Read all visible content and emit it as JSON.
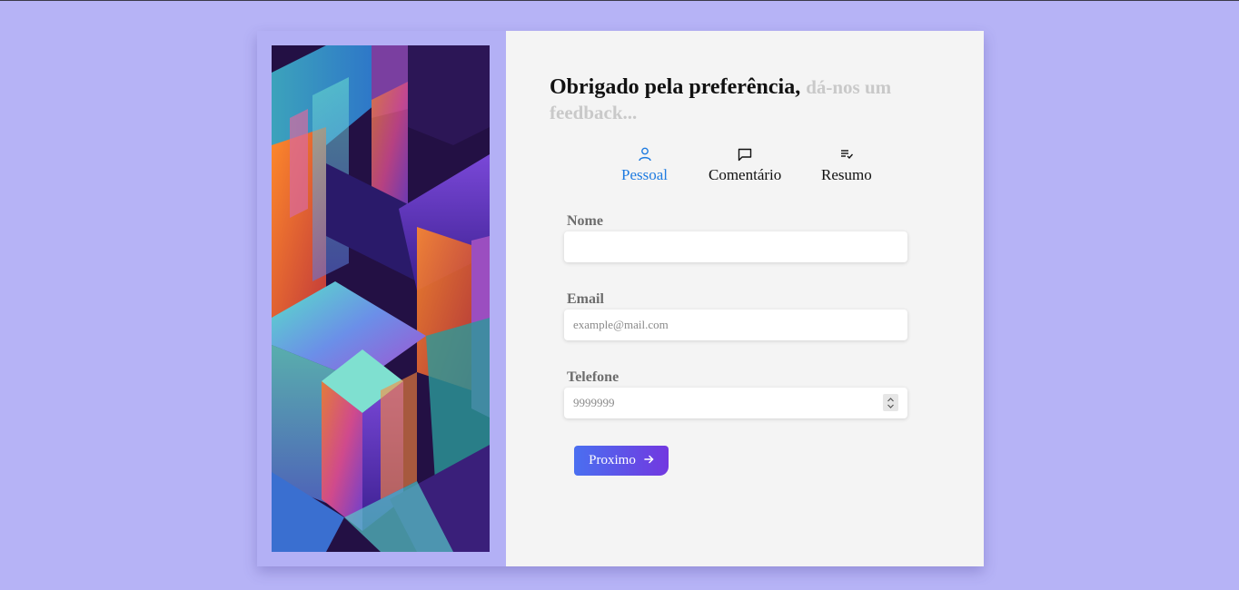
{
  "header": {
    "title_main": "Obrigado pela preferência,",
    "title_muted": "dá-nos um feedback..."
  },
  "steps": [
    {
      "label": "Pessoal",
      "icon": "user-icon",
      "active": true
    },
    {
      "label": "Comentário",
      "icon": "message-square-icon",
      "active": false
    },
    {
      "label": "Resumo",
      "icon": "list-check-icon",
      "active": false
    }
  ],
  "form": {
    "nome": {
      "label": "Nome",
      "value": "",
      "placeholder": ""
    },
    "email": {
      "label": "Email",
      "value": "",
      "placeholder": "example@mail.com"
    },
    "telefone": {
      "label": "Telefone",
      "value": "",
      "placeholder": "9999999"
    }
  },
  "actions": {
    "next_label": "Proximo",
    "next_icon": "arrow-right-icon"
  },
  "colors": {
    "page_background": "#b6b3f6",
    "active_step": "#1e7be0",
    "button_gradient_start": "#4a6ff0",
    "button_gradient_end": "#7238e0"
  }
}
